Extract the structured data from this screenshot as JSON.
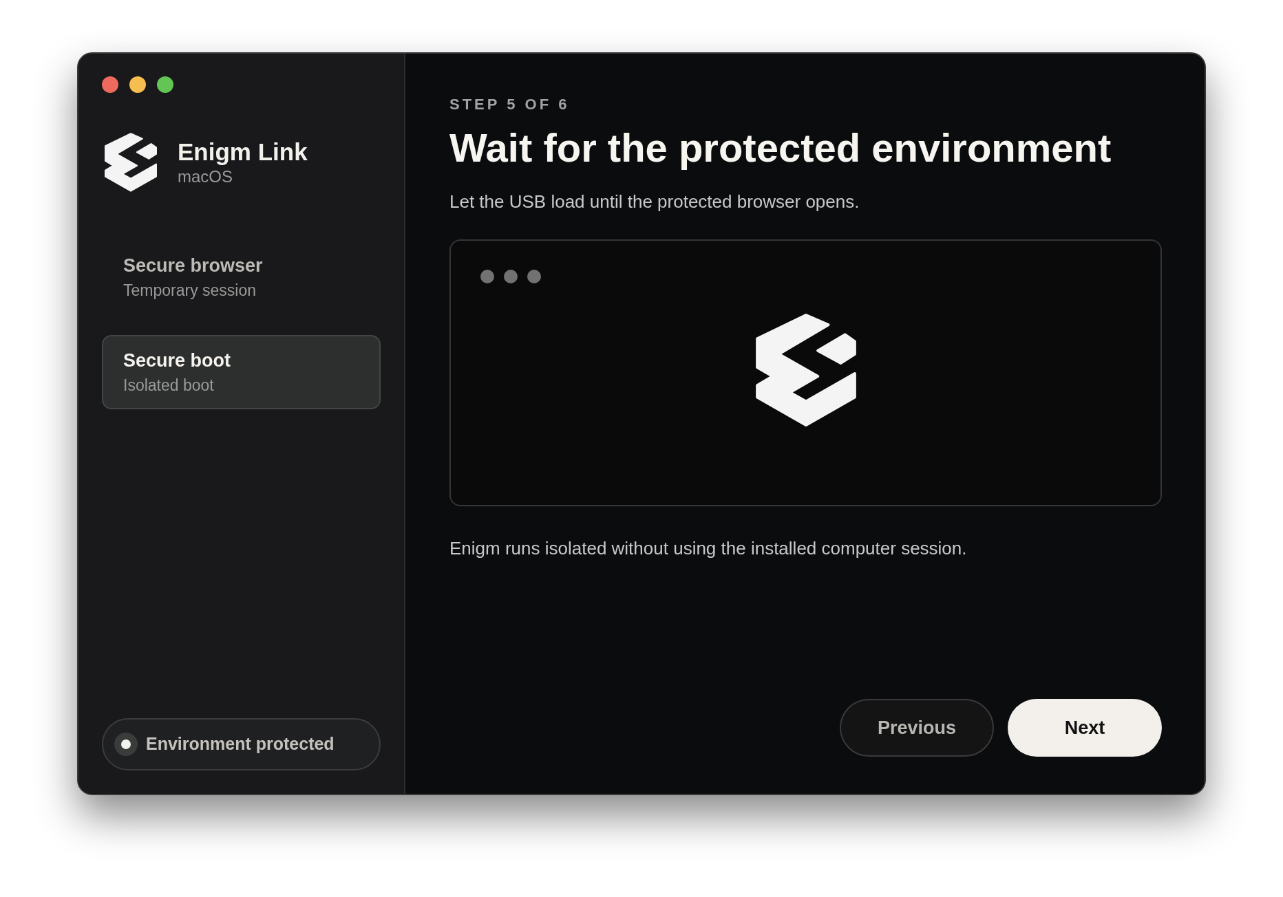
{
  "window": {
    "controls": [
      {
        "color": "#ee6a5f"
      },
      {
        "color": "#f5be4f"
      },
      {
        "color": "#62c554"
      }
    ]
  },
  "sidebar": {
    "app_name": "Enigm Link",
    "platform": "macOS",
    "items": [
      {
        "title": "Secure browser",
        "subtitle": "Temporary session",
        "selected": false
      },
      {
        "title": "Secure boot",
        "subtitle": "Isolated boot",
        "selected": true
      }
    ],
    "status": {
      "label": "Environment protected",
      "on": true
    }
  },
  "main": {
    "step": "STEP 5 OF 6",
    "title": "Wait for the protected environment",
    "description": "Let the USB load until the protected browser opens.",
    "note": "Enigm runs isolated without using the installed computer session.",
    "buttons": [
      {
        "label": "Previous",
        "kind": "secondary"
      },
      {
        "label": "Next",
        "kind": "primary"
      }
    ]
  }
}
